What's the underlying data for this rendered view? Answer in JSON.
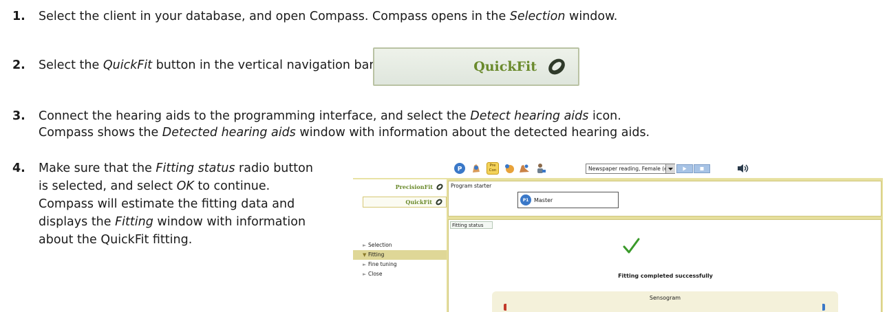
{
  "steps": [
    {
      "num": "1.",
      "text_a": "Select the client in your database, and open Compass. Compass opens in the ",
      "em_a": "Selection",
      "text_b": " window."
    },
    {
      "num": "2.",
      "text_a": "Select the ",
      "em_a": "QuickFit",
      "text_b": " button in the vertical navigation bar."
    },
    {
      "num": "3.",
      "line1_a": "Connect the hearing aids to the programming interface, and select the ",
      "line1_em": "Detect hearing aids",
      "line1_b": " icon.",
      "line2_a": "Compass shows the ",
      "line2_em": "Detected hearing aids",
      "line2_b": " window with information about the detected hearing aids."
    },
    {
      "num": "4.",
      "t1": "Make sure that the ",
      "e1": "Fitting status",
      "t2": " radio button is selected, and select ",
      "e2": "OK",
      "t3": " to continue. Compass will estimate the fitting data and displays the ",
      "e3": "Fitting",
      "t4": " window with information about the QuickFit fitting."
    }
  ],
  "quickfit_image": {
    "label": "QuickFit",
    "logo_icon": "o-ring-icon"
  },
  "screenshot": {
    "toolbar": {
      "icons": [
        "p-circle-icon",
        "hand-icon",
        "precon-icon",
        "sun-icon",
        "hands-icon",
        "person-icon"
      ],
      "precon_label_top": "Pre",
      "precon_label_bottom": "Con",
      "select_value": "Newspaper reading, Female (en-G",
      "speaker_icon": "speaker-icon"
    },
    "sidebar": {
      "buttons": [
        {
          "label": "PrecisionFit"
        },
        {
          "label": "QuickFit"
        }
      ],
      "nav": [
        {
          "label": "Selection",
          "active": false
        },
        {
          "label": "Fitting",
          "active": true
        },
        {
          "label": "Fine tuning",
          "active": false
        },
        {
          "label": "Close",
          "active": false
        }
      ]
    },
    "program_starter": {
      "title": "Program starter",
      "badge": "P1",
      "program": "Master"
    },
    "fitting": {
      "tab": "Fitting status",
      "message": "Fitting completed successfully",
      "sensogram": "Sensogram"
    },
    "colors": {
      "brand_green": "#6a8a2c",
      "accent_yellow": "#e6df9c",
      "left_red": "#c23a2a",
      "right_blue": "#3a78c8"
    }
  }
}
